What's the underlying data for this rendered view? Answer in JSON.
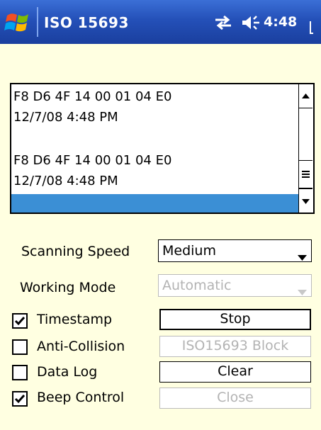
{
  "titlebar": {
    "title": "ISO 15693",
    "time": "4:48",
    "start_icon": "windows-flag-icon",
    "connectivity_icon": "connectivity-icon",
    "volume_icon": "volume-icon",
    "battery_icon": "battery-icon"
  },
  "listbox": {
    "lines": [
      "F8 D6 4F 14 00 01 04 E0",
      "12/7/08 4:48 PM",
      "",
      "F8 D6 4F 14 00 01 04 E0",
      "12/7/08 4:48 PM"
    ],
    "selection_color": "#3b8fd5"
  },
  "form": {
    "scanning_speed_label": "Scanning Speed",
    "scanning_speed_value": "Medium",
    "working_mode_label": "Working Mode",
    "working_mode_value": "Automatic",
    "working_mode_enabled": false,
    "checkboxes": [
      {
        "label": "Timestamp",
        "checked": true
      },
      {
        "label": "Anti-Collision",
        "checked": false
      },
      {
        "label": "Data Log",
        "checked": false
      },
      {
        "label": "Beep Control",
        "checked": true
      }
    ],
    "buttons": [
      {
        "label": "Stop",
        "enabled": true
      },
      {
        "label": "ISO15693  Block",
        "enabled": false
      },
      {
        "label": "Clear",
        "enabled": true
      },
      {
        "label": "Close",
        "enabled": false
      }
    ]
  },
  "colors": {
    "background": "#ffffe1",
    "titlebar": "#2450b8",
    "disabled_text": "#b3b3b3"
  }
}
